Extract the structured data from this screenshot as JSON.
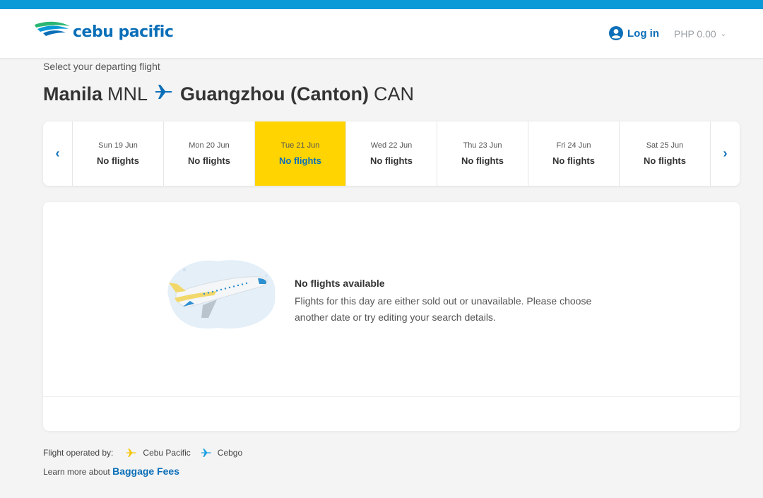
{
  "header": {
    "brand": "cebu pacific",
    "login_label": "Log in",
    "currency_label": "PHP 0.00"
  },
  "page": {
    "subtitle": "Select your departing flight",
    "origin_city": "Manila",
    "origin_code": "MNL",
    "destination_city": "Guangzhou (Canton)",
    "destination_code": "CAN"
  },
  "dates": [
    {
      "day": "Sun 19 Jun",
      "status": "No flights",
      "selected": false
    },
    {
      "day": "Mon 20 Jun",
      "status": "No flights",
      "selected": false
    },
    {
      "day": "Tue 21 Jun",
      "status": "No flights",
      "selected": true
    },
    {
      "day": "Wed 22 Jun",
      "status": "No flights",
      "selected": false
    },
    {
      "day": "Thu 23 Jun",
      "status": "No flights",
      "selected": false
    },
    {
      "day": "Fri 24 Jun",
      "status": "No flights",
      "selected": false
    },
    {
      "day": "Sat 25 Jun",
      "status": "No flights",
      "selected": false
    }
  ],
  "nav": {
    "prev_icon": "chevron-left-icon",
    "next_icon": "chevron-right-icon"
  },
  "empty_state": {
    "title": "No flights available",
    "line1": "Flights for this day are either sold out or unavailable. Please choose",
    "line2": "another date or try editing your search details."
  },
  "footer": {
    "operated_label": "Flight operated by:",
    "operators": [
      {
        "name": "Cebu Pacific",
        "color": "#f5c400"
      },
      {
        "name": "Cebgo",
        "color": "#1a9fe0"
      }
    ],
    "learn_more": "Learn more about",
    "baggage_link": "Baggage Fees"
  },
  "colors": {
    "brand_blue": "#0b6fb8",
    "selected_yellow": "#ffd400",
    "top_bar": "#0a9ad8"
  }
}
